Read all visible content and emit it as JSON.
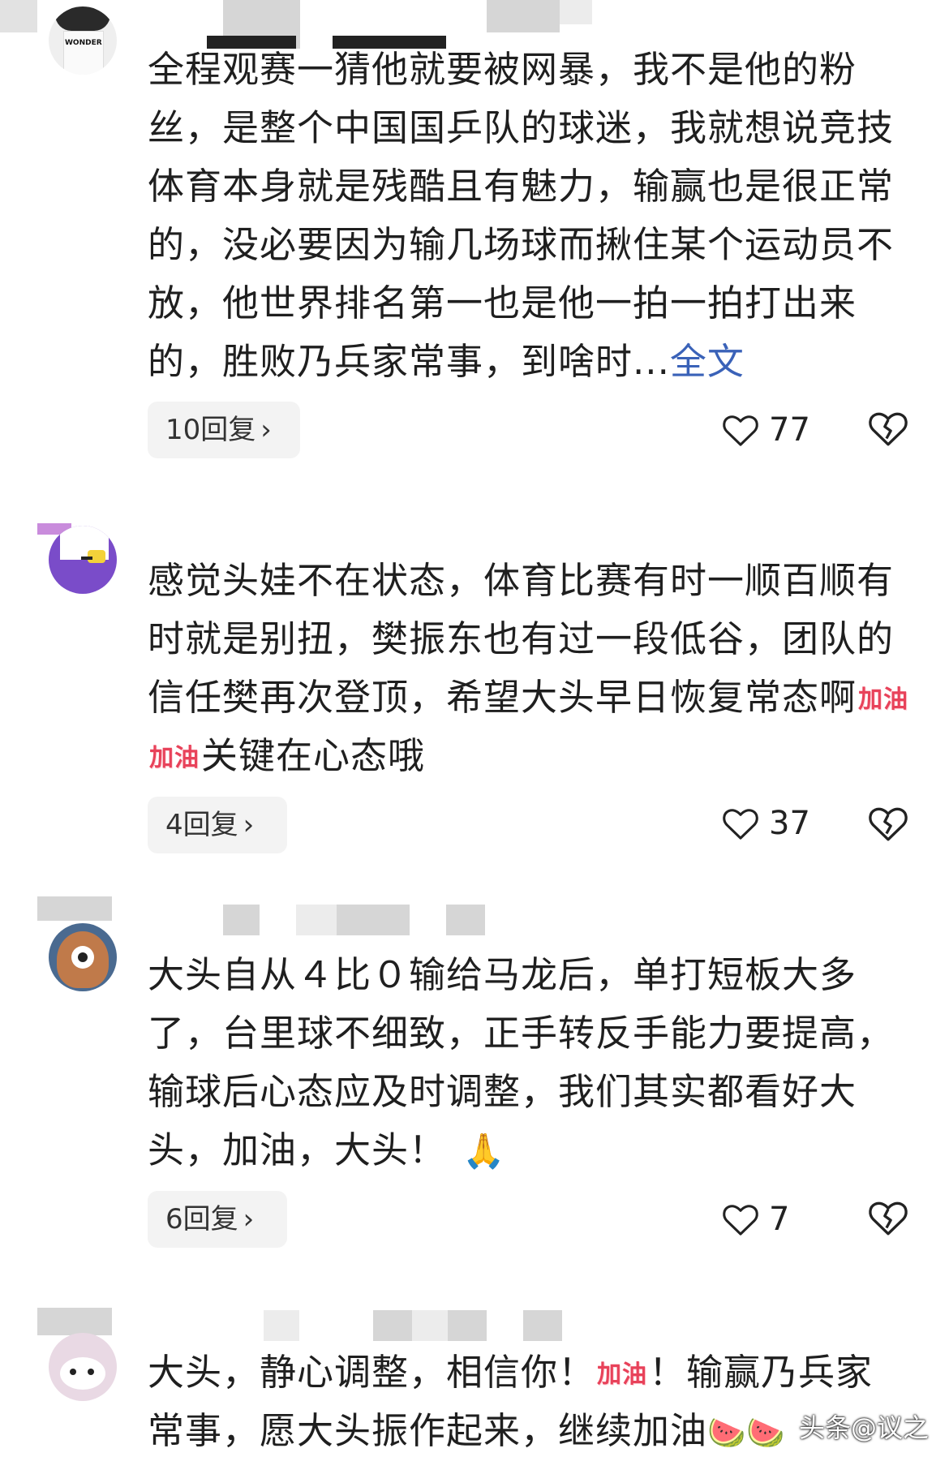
{
  "comments": [
    {
      "text": "全程观赛一猜他就要被网暴，我不是他的粉丝，是整个中国国乒队的球迷，我就想说竞技体育本身就是残酷且有魅力，输赢也是很正常的，没必要因为输几场球而揪住某个运动员不放，他世界排名第一也是他一拍一拍打出来的，胜败乃兵家常事，到啥时...",
      "full_link": "全文",
      "replies": "10回复",
      "likes": "77",
      "avatar_label": "WONDER"
    },
    {
      "text_before": "感觉头娃不在状态，体育比赛有时一顺百顺有时就是别扭，樊振东也有过一段低谷，团队的信任樊再次登顶，希望大头早日恢复常态啊",
      "emoji_1": "加油",
      "emoji_2": "加油",
      "text_after": "关键在心态哦",
      "replies": "4回复",
      "likes": "37"
    },
    {
      "text": "大头自从４比０输给马龙后，单打短板大多了，台里球不细致，正手转反手能力要提高，输球后心态应及时调整，我们其实都看好大头，加油，大头！",
      "emoji": "🙏",
      "replies": "6回复",
      "likes": "7"
    },
    {
      "text_before": "大头，静心调整，相信你！",
      "emoji_1": "加油",
      "text_after": "！输赢乃兵家常事，愿大头振作起来，继续加油",
      "emoji_2": "🍉🍉"
    }
  ],
  "watermark": "头条@议之",
  "colors": {
    "link": "#3a62b8",
    "reply_bg": "#f3f3f3",
    "text": "#1f1f1f"
  },
  "icons": [
    "heart-outline-icon",
    "broken-heart-icon",
    "chevron-right-icon"
  ]
}
